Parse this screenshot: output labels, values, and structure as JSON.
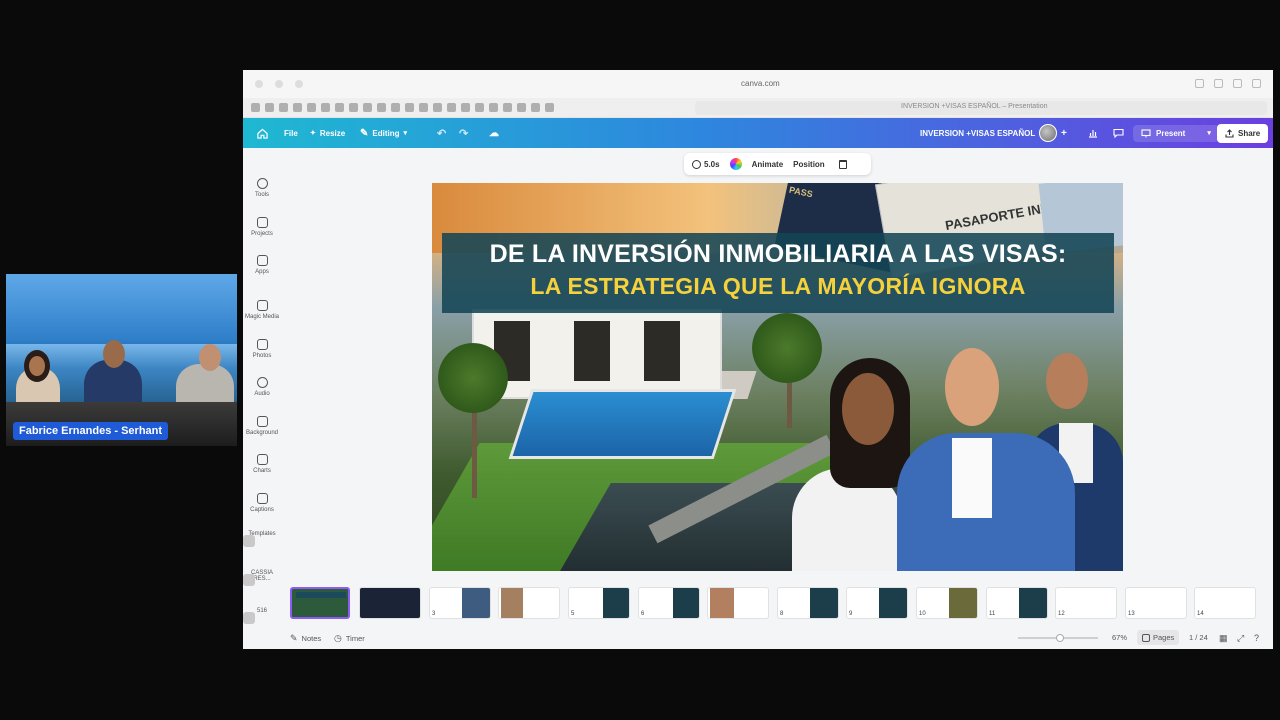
{
  "webcam": {
    "name_tag": "Fabrice Ernandes - Serhant"
  },
  "browser": {
    "url": "canva.com",
    "tab_title": "INVERSION +VISAS ESPAÑOL – Presentation"
  },
  "topbar": {
    "file": "File",
    "resize": "Resize",
    "editing": "Editing",
    "doc_name": "INVERSION +VISAS ESPAÑOL",
    "present": "Present",
    "share": "Share"
  },
  "rail": {
    "items": [
      {
        "label": "Tools",
        "icon": "pen-icon"
      },
      {
        "label": "Projects",
        "icon": "folder-icon"
      },
      {
        "label": "Apps",
        "icon": "apps-icon"
      },
      {
        "label": "Magic Media",
        "icon": "magic-media-icon"
      },
      {
        "label": "Photos",
        "icon": "image-icon"
      },
      {
        "label": "Audio",
        "icon": "music-icon"
      },
      {
        "label": "Background",
        "icon": "background-icon"
      },
      {
        "label": "Charts",
        "icon": "chart-icon"
      },
      {
        "label": "Captions",
        "icon": "captions-icon"
      },
      {
        "label": "Templates",
        "icon": "template-icon"
      },
      {
        "label": "CASSIA RES...",
        "icon": "folder-thumb-icon"
      },
      {
        "label": "516",
        "icon": "folder-thumb-icon"
      }
    ]
  },
  "context_bar": {
    "duration": "5.0s",
    "animate": "Animate",
    "position": "Position"
  },
  "slide": {
    "headline_1": "DE LA INVERSIÓN INMOBILIARIA A LAS VISAS:",
    "headline_2": "LA ESTRATEGIA QUE LA MAYORÍA IGNORA",
    "passport_text": "PASAPORTE INMOBILIARIO",
    "passport_cover_text": "PASS"
  },
  "filmstrip": {
    "pages": [
      "1",
      "2",
      "3",
      "4",
      "5",
      "6",
      "7",
      "8",
      "9",
      "10",
      "11",
      "12",
      "13",
      "14"
    ]
  },
  "bottom": {
    "notes": "Notes",
    "timer": "Timer",
    "zoom": "67%",
    "pages": "Pages",
    "page_count": "1 / 24"
  }
}
